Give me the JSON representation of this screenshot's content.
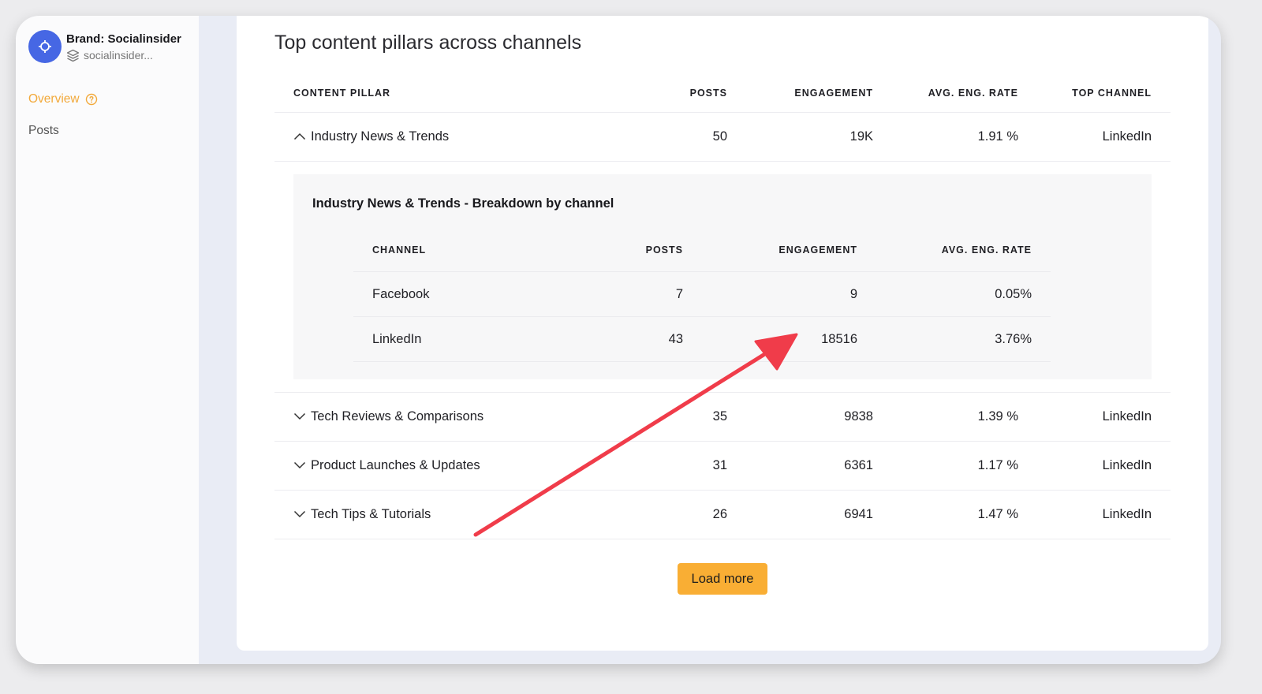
{
  "brand": {
    "name": "Brand: Socialinsider",
    "account": "socialinsider..."
  },
  "nav": {
    "overview": "Overview",
    "posts": "Posts"
  },
  "section": {
    "title": "Top content pillars across channels"
  },
  "table": {
    "headers": {
      "pillar": "CONTENT PILLAR",
      "posts": "POSTS",
      "engagement": "ENGAGEMENT",
      "rate": "AVG. ENG. RATE",
      "channel": "TOP CHANNEL"
    },
    "rows": [
      {
        "pillar": "Industry News & Trends",
        "posts": "50",
        "engagement": "19K",
        "rate": "1.91 %",
        "channel": "LinkedIn",
        "expanded": true
      },
      {
        "pillar": "Tech Reviews & Comparisons",
        "posts": "35",
        "engagement": "9838",
        "rate": "1.39 %",
        "channel": "LinkedIn",
        "expanded": false
      },
      {
        "pillar": "Product Launches & Updates",
        "posts": "31",
        "engagement": "6361",
        "rate": "1.17 %",
        "channel": "LinkedIn",
        "expanded": false
      },
      {
        "pillar": "Tech Tips & Tutorials",
        "posts": "26",
        "engagement": "6941",
        "rate": "1.47 %",
        "channel": "LinkedIn",
        "expanded": false
      }
    ]
  },
  "breakdown": {
    "title": "Industry News & Trends - Breakdown by channel",
    "headers": {
      "channel": "CHANNEL",
      "posts": "POSTS",
      "engagement": "ENGAGEMENT",
      "rate": "AVG. ENG. RATE"
    },
    "rows": [
      {
        "channel": "Facebook",
        "posts": "7",
        "engagement": "9",
        "rate": "0.05%"
      },
      {
        "channel": "LinkedIn",
        "posts": "43",
        "engagement": "18516",
        "rate": "3.76%"
      }
    ]
  },
  "load_more": "Load more",
  "colors": {
    "accent": "#f9ae34",
    "brand_logo": "#4667e4",
    "annotation_arrow": "#f03c4a"
  },
  "icons": {
    "brand": "crosshair-icon",
    "account": "layers-icon",
    "help": "help-circle-icon",
    "expanded": "chevron-up-icon",
    "collapsed": "chevron-down-icon"
  }
}
